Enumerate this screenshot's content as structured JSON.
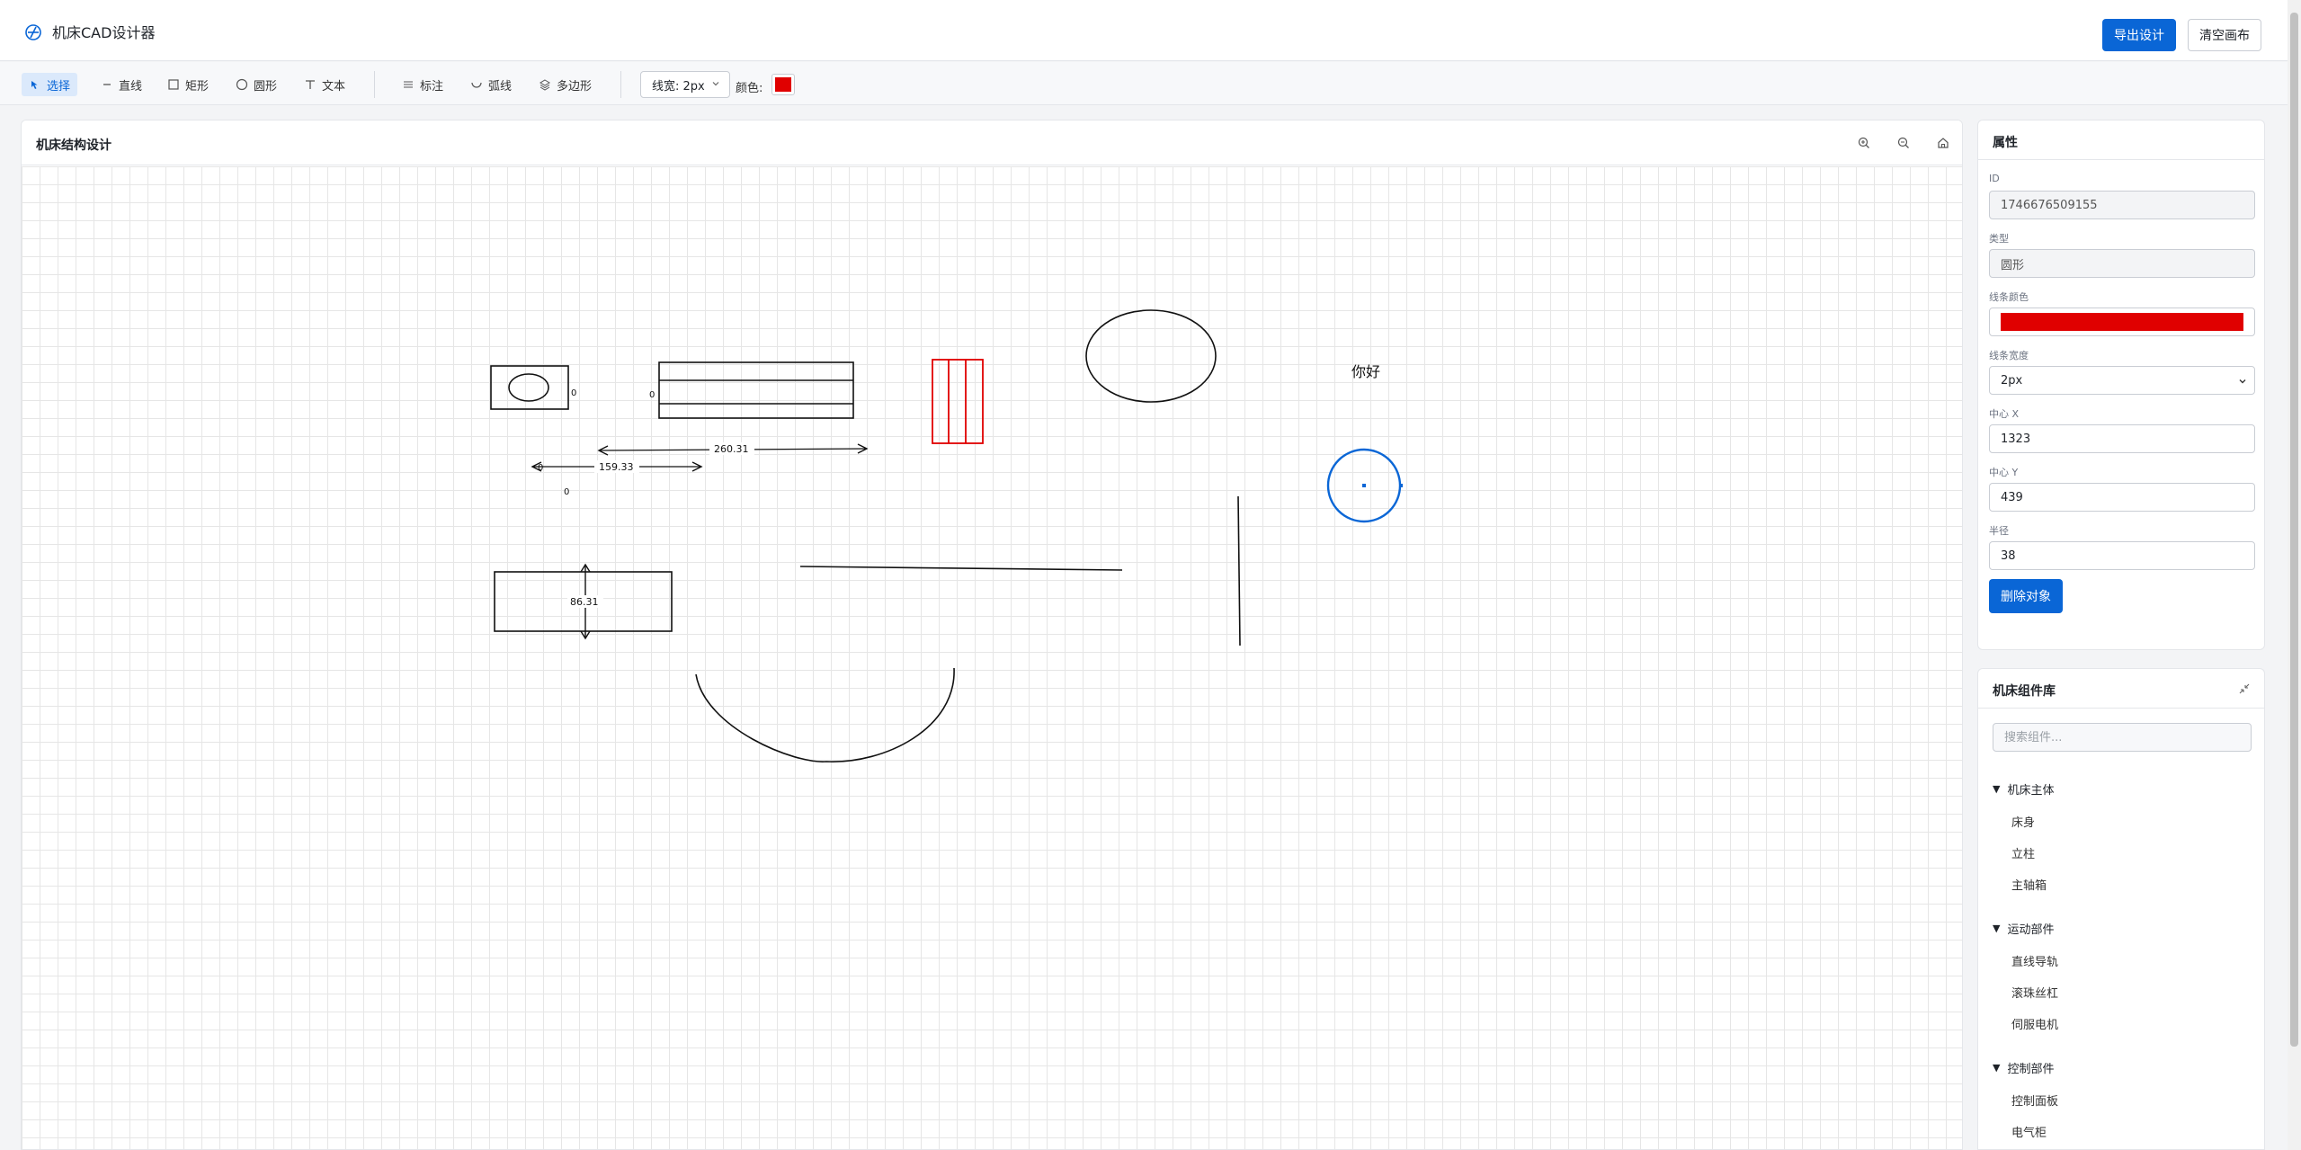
{
  "header": {
    "title": "机床CAD设计器",
    "export_label": "导出设计",
    "clear_label": "清空画布"
  },
  "toolbar": {
    "tools": [
      {
        "label": "选择",
        "icon": "pointer-icon",
        "active": true
      },
      {
        "label": "直线",
        "icon": "line-icon"
      },
      {
        "label": "矩形",
        "icon": "rectangle-icon"
      },
      {
        "label": "圆形",
        "icon": "circle-icon"
      },
      {
        "label": "文本",
        "icon": "text-icon"
      },
      {
        "label": "标注",
        "icon": "dimension-icon"
      },
      {
        "label": "弧线",
        "icon": "arc-icon"
      },
      {
        "label": "多边形",
        "icon": "polygon-icon"
      }
    ],
    "line_width": "线宽: 2px",
    "color_label": "颜色:",
    "color_value": "#e00000"
  },
  "canvas": {
    "title": "机床结构设计",
    "zoom_in_icon": "zoom-in-icon",
    "zoom_out_icon": "zoom-out-icon",
    "home_icon": "home-icon",
    "text_object": "你好",
    "dimensions": [
      "260.31",
      "159.33",
      "86.31"
    ],
    "small_labels": [
      "0",
      "0",
      "0",
      "0"
    ]
  },
  "properties": {
    "title": "属性",
    "id_label": "ID",
    "id_value": "1746676509155",
    "type_label": "类型",
    "type_value": "圆形",
    "stroke_color_label": "线条颜色",
    "stroke_color_value": "#e00000",
    "stroke_width_label": "线条宽度",
    "stroke_width_value": "2px",
    "center_x_label": "中心 X",
    "center_x_value": "1323",
    "center_y_label": "中心 Y",
    "center_y_value": "439",
    "radius_label": "半径",
    "radius_value": "38",
    "delete_label": "删除对象"
  },
  "library": {
    "title": "机床组件库",
    "search_placeholder": "搜索组件...",
    "categories": [
      {
        "name": "机床主体",
        "items": [
          "床身",
          "立柱",
          "主轴箱"
        ]
      },
      {
        "name": "运动部件",
        "items": [
          "直线导轨",
          "滚珠丝杠",
          "伺服电机"
        ]
      },
      {
        "name": "控制部件",
        "items": [
          "控制面板",
          "电气柜"
        ]
      }
    ]
  }
}
